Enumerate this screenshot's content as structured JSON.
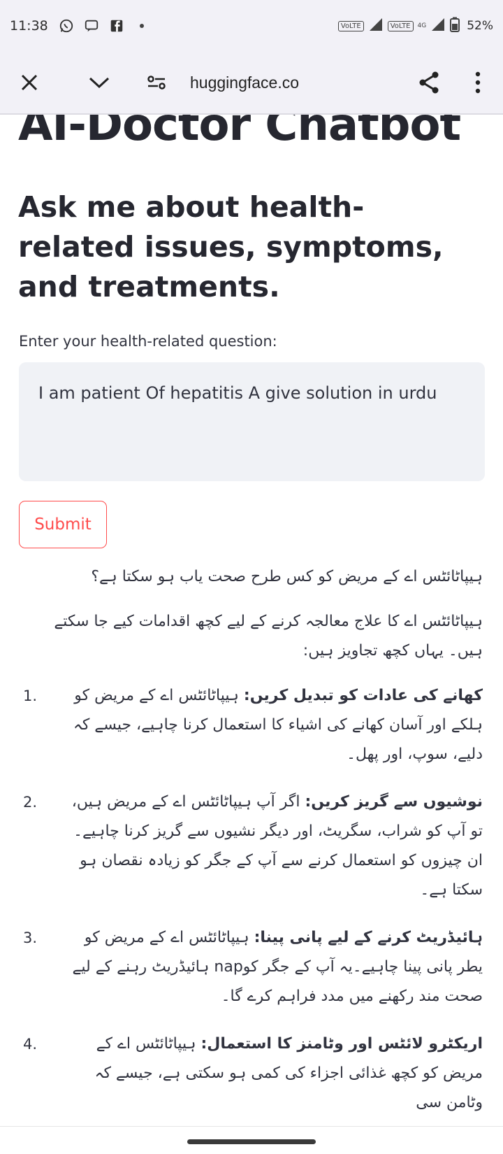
{
  "status": {
    "time": "11:38",
    "volte1": "VoLTE",
    "volte2": "VoLTE",
    "net": "4G",
    "battery": "52%"
  },
  "browser": {
    "url": "huggingface.co"
  },
  "app": {
    "title": "AI-Doctor Chatbot",
    "subtitle": "Ask me about health-related issues, symptoms, and treatments.",
    "input_label": "Enter your health-related question:",
    "input_value": "I am patient Of hepatitis A give solution in urdu",
    "submit_label": "Submit"
  },
  "answer": {
    "question": "ہیپاٹائٹس اے کے مریض کو کس طرح صحت یاب ہو سکتا ہے؟",
    "intro": "ہیپاٹائٹس اے کا علاج معالجہ کرنے کے لیے کچھ اقدامات کیے جا سکتے ہیں۔ یہاں کچھ تجاویز ہیں:",
    "items": [
      {
        "num": "1.",
        "title": "کھانے کی عادات کو تبدیل کریں:",
        "text": " ہیپاٹائٹس اے کے مریض کو ہلکے اور آسان کھانے کی اشیاء کا استعمال کرنا چاہیے، جیسے کہ دلیے، سوپ، اور پھل۔"
      },
      {
        "num": "2.",
        "title": "نوشیوں سے گریز کریں:",
        "text": " اگر آپ ہیپاٹائٹس اے کے مریض ہیں، تو آپ کو شراب، سگریٹ، اور دیگر نشیوں سے گریز کرنا چاہیے۔ ان چیزوں کو استعمال کرنے سے آپ کے جگر کو زیادہ نقصان ہو سکتا ہے۔"
      },
      {
        "num": "3.",
        "title": "ہائیڈریٹ کرنے کے لیے پانی پینا:",
        "text": " ہیپاٹائٹس اے کے مریض کو یطر پانی پینا چاہیے۔یہ آپ کے جگر کوnap ہائیڈریٹ رہنے کے لیے صحت مند رکھنے میں مدد فراہم کرے گا۔"
      },
      {
        "num": "4.",
        "title": "اریکٹرو لائٹس اور وٹامنز کا استعمال:",
        "text": " ہیپاٹائٹس اے کے مریض کو کچھ غذائی اجزاء کی کمی ہو سکتی ہے، جیسے کہ وٹامن سی"
      }
    ]
  }
}
